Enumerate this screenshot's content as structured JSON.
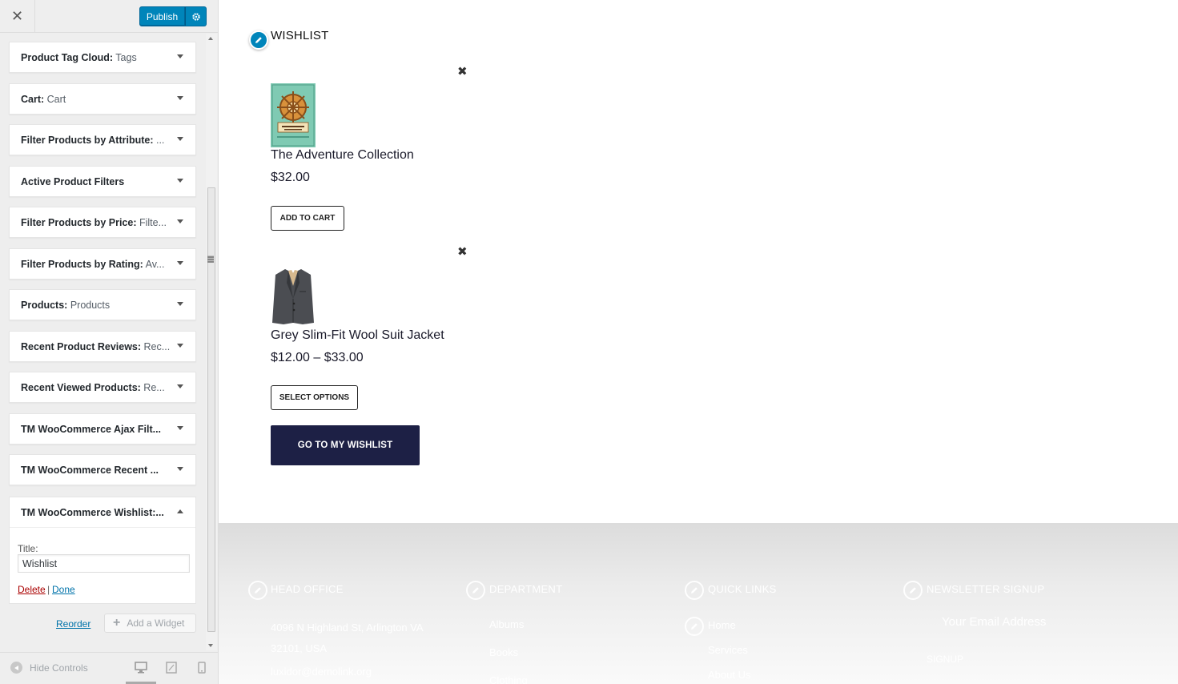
{
  "header": {
    "close_glyph": "✕",
    "publish_label": "Publish"
  },
  "widgets": [
    {
      "name": "Product Tag Cloud:",
      "sub": " Tags"
    },
    {
      "name": "Cart:",
      "sub": " Cart"
    },
    {
      "name": "Filter Products by Attribute:",
      "sub": " ..."
    },
    {
      "name": "Active Product Filters",
      "sub": ""
    },
    {
      "name": "Filter Products by Price:",
      "sub": " Filte..."
    },
    {
      "name": "Filter Products by Rating:",
      "sub": " Av..."
    },
    {
      "name": "Products:",
      "sub": " Products"
    },
    {
      "name": "Recent Product Reviews:",
      "sub": " Rec..."
    },
    {
      "name": "Recent Viewed Products:",
      "sub": " Re..."
    },
    {
      "name": "TM WooCommerce Ajax Filt...",
      "sub": ""
    },
    {
      "name": "TM WooCommerce Recent ...",
      "sub": ""
    }
  ],
  "open_widget": {
    "name": "TM WooCommerce Wishlist:...",
    "title_label": "Title:",
    "title_value": "Wishlist",
    "delete_label": "Delete",
    "separator": "|",
    "done_label": "Done"
  },
  "actions": {
    "reorder_label": "Reorder",
    "add_widget_label": "Add a Widget"
  },
  "sidebar_footer": {
    "hide_controls_label": "Hide Controls"
  },
  "preview": {
    "wishlist_title": "WISHLIST",
    "products": [
      {
        "name": "The Adventure Collection",
        "price": "$32.00",
        "button": "ADD TO CART",
        "image": "book-cover-icon"
      },
      {
        "name": "Grey Slim-Fit Wool Suit Jacket",
        "price": "$12.00 – $33.00",
        "button": "SELECT OPTIONS",
        "image": "suit-jacket-icon"
      }
    ],
    "go_to_wishlist": "GO TO MY WISHLIST",
    "remove_glyph": "✖"
  },
  "site_footer": {
    "head_office": "HEAD OFFICE",
    "address_line1": "4096 N Highland St, Arlington VA",
    "address_line2": "32101, USA",
    "email": "luxidor@demolink.org",
    "department": "DEPARTMENT",
    "dept_items": [
      "Albums",
      "Books",
      "Clothing"
    ],
    "quick_links": "QUICK LINKS",
    "quick_items": [
      "Home",
      "Services",
      "About Us"
    ],
    "newsletter": "NEWSLETTER SIGNUP",
    "email_placeholder": "Your Email Address",
    "signup": "SIGNUP"
  },
  "colors": {
    "accent": "#0085ba",
    "dark_button": "#1d2045",
    "delete": "#aa0000",
    "link": "#0073aa"
  }
}
